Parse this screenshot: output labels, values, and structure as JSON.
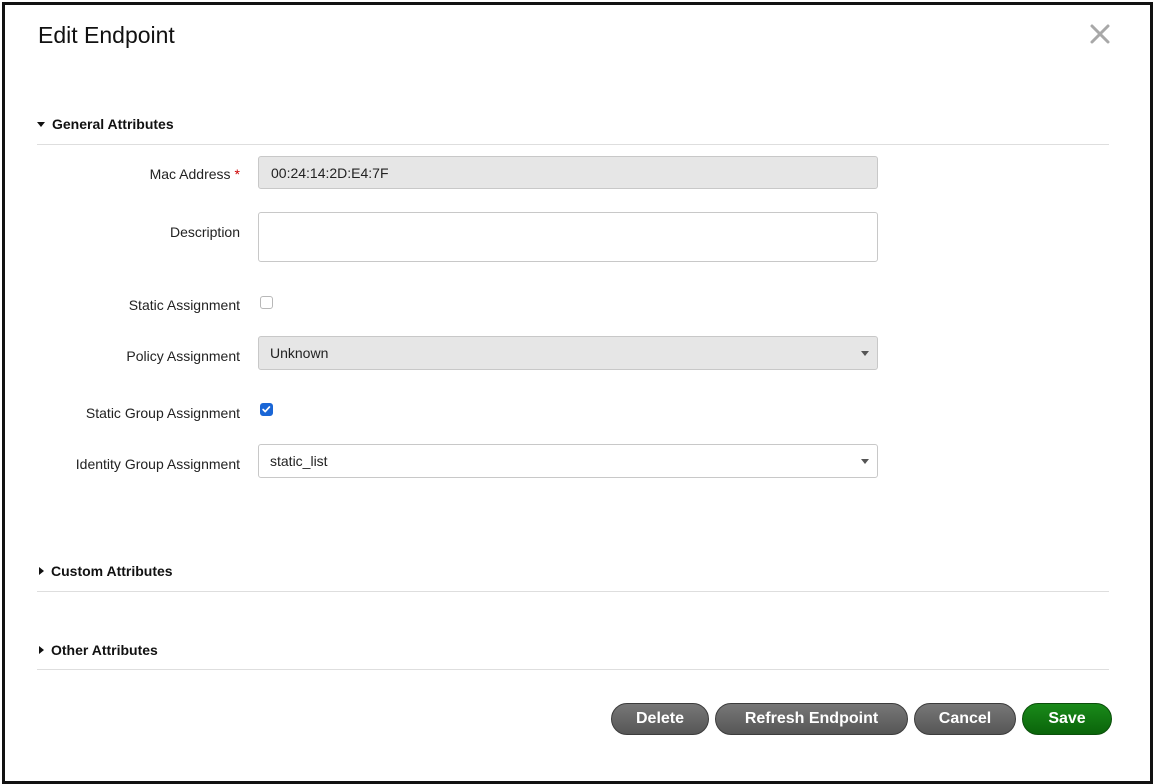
{
  "dialog": {
    "title": "Edit Endpoint"
  },
  "sections": {
    "general": {
      "label": "General Attributes",
      "expanded": true
    },
    "custom": {
      "label": "Custom Attributes",
      "expanded": false
    },
    "other": {
      "label": "Other Attributes",
      "expanded": false
    }
  },
  "fields": {
    "mac_address": {
      "label": "Mac Address",
      "required_mark": "*",
      "value": "00:24:14:2D:E4:7F"
    },
    "description": {
      "label": "Description",
      "value": ""
    },
    "static_assignment": {
      "label": "Static Assignment",
      "checked": false
    },
    "policy_assignment": {
      "label": "Policy Assignment",
      "selected": "Unknown"
    },
    "static_group_assignment": {
      "label": "Static Group Assignment",
      "checked": true
    },
    "identity_group_assignment": {
      "label": "Identity Group Assignment",
      "selected": "static_list"
    }
  },
  "buttons": {
    "delete": "Delete",
    "refresh": "Refresh Endpoint",
    "cancel": "Cancel",
    "save": "Save"
  },
  "icons": {
    "close": "close-icon",
    "checkmark": "checkmark-icon",
    "chevron": "chevron-down-icon"
  },
  "colors": {
    "primary_button": "#0a640a",
    "secondary_button": "#565656",
    "checkbox_accent": "#1a66d6",
    "required": "#cc0000"
  }
}
